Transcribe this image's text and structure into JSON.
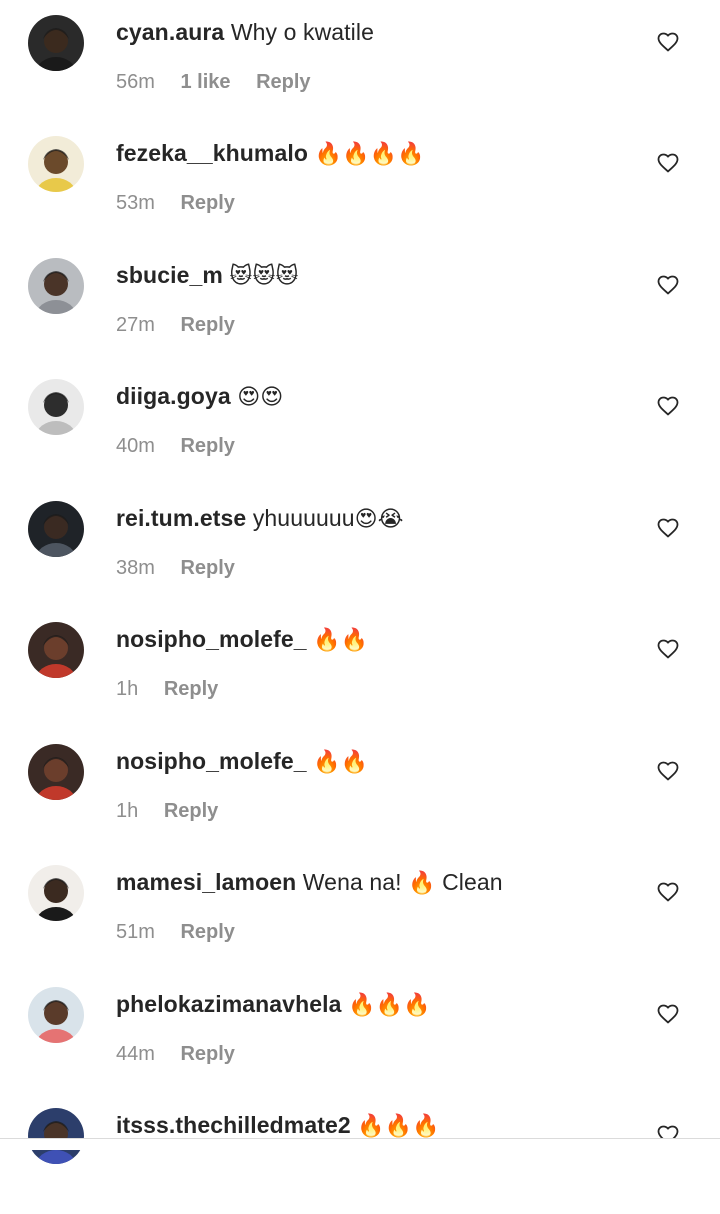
{
  "comments": [
    {
      "user": "cyan.aura",
      "text": "Why o kwatile",
      "emoji": "",
      "time": "56m",
      "likes": "1 like",
      "reply": "Reply",
      "avatar": {
        "bg": "#2a2a2a",
        "face": "#3b2a1e",
        "accent": "#1a1a1a"
      }
    },
    {
      "user": "fezeka__khumalo",
      "text": "",
      "emoji": "🔥🔥🔥🔥",
      "time": "53m",
      "likes": "",
      "reply": "Reply",
      "avatar": {
        "bg": "#f2ecd8",
        "face": "#6b4a2b",
        "accent": "#e8c94a"
      }
    },
    {
      "user": "sbucie_m",
      "text": "",
      "emoji": "😻😻😻",
      "time": "27m",
      "likes": "",
      "reply": "Reply",
      "avatar": {
        "bg": "#b9bcc0",
        "face": "#4a3428",
        "accent": "#8d9096"
      }
    },
    {
      "user": "diiga.goya",
      "text": "",
      "emoji": "😍😍",
      "time": "40m",
      "likes": "",
      "reply": "Reply",
      "avatar": {
        "bg": "#e9e9e9",
        "face": "#2d2d2d",
        "accent": "#bdbdbd"
      }
    },
    {
      "user": "rei.tum.etse",
      "text": "yhuuuuuu",
      "emoji": "😍😭",
      "time": "38m",
      "likes": "",
      "reply": "Reply",
      "avatar": {
        "bg": "#1f2328",
        "face": "#3a2a22",
        "accent": "#4d5560"
      }
    },
    {
      "user": "nosipho_molefe_",
      "text": "",
      "emoji": "🔥🔥",
      "time": "1h",
      "likes": "",
      "reply": "Reply",
      "avatar": {
        "bg": "#3a2a25",
        "face": "#6b3e2c",
        "accent": "#c0392b"
      }
    },
    {
      "user": "nosipho_molefe_",
      "text": "",
      "emoji": "🔥🔥",
      "time": "1h",
      "likes": "",
      "reply": "Reply",
      "avatar": {
        "bg": "#3a2a25",
        "face": "#6b3e2c",
        "accent": "#c0392b"
      }
    },
    {
      "user": "mamesi_lamoen",
      "text": "Wena na! ",
      "emoji": "🔥",
      "text_after": " Clean",
      "time": "51m",
      "likes": "",
      "reply": "Reply",
      "avatar": {
        "bg": "#f1eeea",
        "face": "#3b2a20",
        "accent": "#1a1a1a"
      }
    },
    {
      "user": "phelokazimanavhela",
      "text": "",
      "emoji": "🔥🔥🔥",
      "time": "44m",
      "likes": "",
      "reply": "Reply",
      "avatar": {
        "bg": "#d9e3ea",
        "face": "#5a3b2a",
        "accent": "#e57373"
      }
    },
    {
      "user": "itsss.thechilledmate2",
      "text": "",
      "emoji": "🔥🔥🔥",
      "time": "",
      "likes": "",
      "reply": "",
      "avatar": {
        "bg": "#2c3e6b",
        "face": "#4a3428",
        "accent": "#3f51b5"
      }
    }
  ],
  "colors": {
    "username": "#262626",
    "meta": "#8e8e8e",
    "heart": "#262626",
    "fire": "#f4511e"
  }
}
